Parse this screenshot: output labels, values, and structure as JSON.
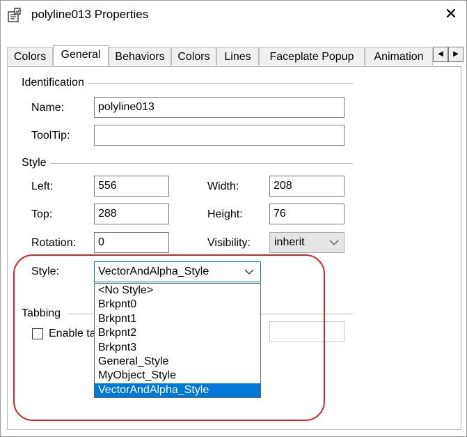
{
  "window": {
    "title": "polyline013 Properties",
    "close_label": "✕"
  },
  "tabs": [
    {
      "label": "Colors"
    },
    {
      "label": "General"
    },
    {
      "label": "Behaviors"
    },
    {
      "label": "Colors"
    },
    {
      "label": "Lines"
    },
    {
      "label": "Faceplate Popup"
    },
    {
      "label": "Animation"
    }
  ],
  "active_tab": "General",
  "tab_scroll": {
    "left": "◀",
    "right": "▶"
  },
  "identification": {
    "heading": "Identification",
    "name_label": "Name:",
    "name_value": "polyline013",
    "tooltip_label": "ToolTip:",
    "tooltip_value": ""
  },
  "style_section": {
    "heading": "Style",
    "left_label": "Left:",
    "left_value": "556",
    "width_label": "Width:",
    "width_value": "208",
    "top_label": "Top:",
    "top_value": "288",
    "height_label": "Height:",
    "height_value": "76",
    "rotation_label": "Rotation:",
    "rotation_value": "0",
    "visibility_label": "Visibility:",
    "visibility_value": "inherit",
    "style_label": "Style:",
    "style_value": "VectorAndAlpha_Style",
    "style_options": [
      "<No Style>",
      "Brkpnt0",
      "Brkpnt1",
      "Brkpnt2",
      "Brkpnt3",
      "General_Style",
      "MyObject_Style",
      "VectorAndAlpha_Style"
    ],
    "selected_option_index": 7
  },
  "tabbing": {
    "heading": "Tabbing",
    "enable_label": "Enable ta"
  },
  "colors": {
    "accent": "#0078d7",
    "highlight": "#d9252a"
  }
}
